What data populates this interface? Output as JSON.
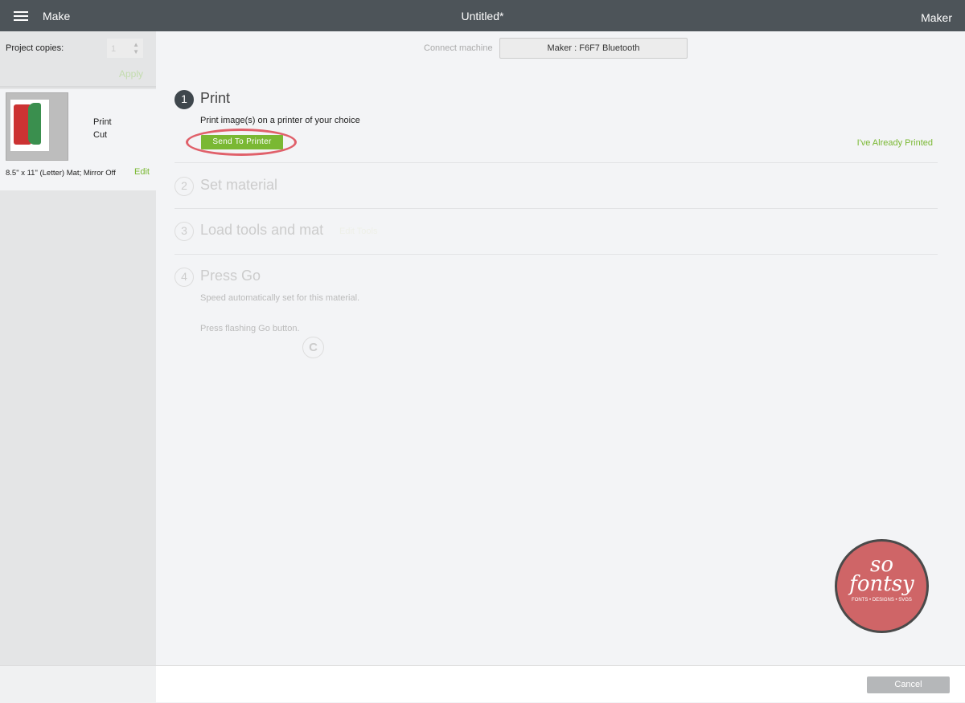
{
  "topbar": {
    "make_label": "Make",
    "title": "Untitled*",
    "machine": "Maker"
  },
  "sidebar": {
    "copies_label": "Project copies:",
    "copies_value": "1",
    "apply_label": "Apply",
    "mat": {
      "operations": [
        "Print",
        "Cut"
      ],
      "description": "8.5\" x 11\" (Letter) Mat; Mirror Off",
      "edit_label": "Edit"
    }
  },
  "main": {
    "connect_label": "Connect machine",
    "machine_button": "Maker : F6F7 Bluetooth",
    "steps": [
      {
        "number": "1",
        "title": "Print",
        "description": "Print image(s) on a printer of your choice",
        "button": "Send To Printer",
        "already_printed": "I've Already Printed"
      },
      {
        "number": "2",
        "title": "Set material"
      },
      {
        "number": "3",
        "title": "Load tools and mat",
        "edit_tools": "Edit Tools"
      },
      {
        "number": "4",
        "title": "Press Go",
        "description": "Speed automatically set for this material.",
        "go_text": "Press flashing Go button."
      }
    ]
  },
  "logo": {
    "line1": "so",
    "line2": "fontsy",
    "tagline": "FONTS • DESIGNS • SVGS"
  },
  "footer": {
    "cancel_label": "Cancel"
  },
  "colors": {
    "accent": "#7ab833",
    "topbar": "#4d5459",
    "highlight": "#e0606a"
  }
}
